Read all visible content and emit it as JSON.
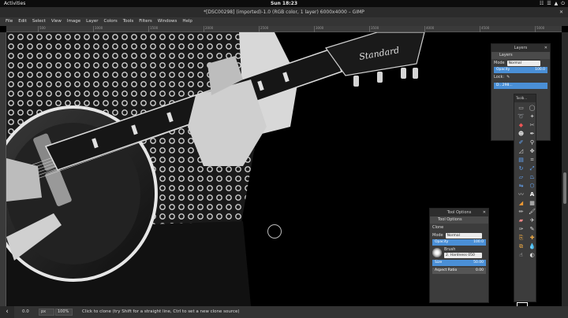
{
  "topbar": {
    "activities": "Activities",
    "clock": "Sun 18:23",
    "system_icons": [
      "☷",
      "☰",
      "▲",
      "⏻"
    ]
  },
  "window": {
    "title": "*[DSC00298] (imported)-1.0 (RGB color, 1 layer) 6000x4000 – GIMP",
    "close": "✕"
  },
  "menu": [
    "File",
    "Edit",
    "Select",
    "View",
    "Image",
    "Layer",
    "Colors",
    "Tools",
    "Filters",
    "Windows",
    "Help"
  ],
  "ruler_ticks": [
    "500",
    "1000",
    "1500",
    "2000",
    "2500",
    "3000",
    "3500",
    "4000",
    "4500",
    "5000"
  ],
  "layers": {
    "title": "Layers",
    "tab": "Layers",
    "mode_label": "Mode",
    "mode_value": "Normal",
    "opacity_label": "Opacity",
    "opacity_value": "100.0",
    "lock_label": "Lock:",
    "layer_name": "D...298..."
  },
  "toolbox": {
    "title": "Toolb..."
  },
  "tool_options": {
    "title": "Tool Options",
    "tab": "Tool Options",
    "heading": "Clone",
    "mode_label": "Mode",
    "mode_value": "Normal",
    "opacity_label": "Opacity",
    "opacity_value": "100.0",
    "brush_label": "Brush",
    "brush_value": "2. Hardness 050",
    "size_label": "Size",
    "size_value": "50.00",
    "aspect_label": "Aspect Ratio",
    "aspect_value": "0.00"
  },
  "status": {
    "coord": "0.0",
    "unit": "px",
    "zoom": "100%",
    "message": "Click to clone (try Shift for a straight line, Ctrl to set a new clone source)",
    "back": "‹"
  },
  "photo": {
    "guitar_brand": "Standard"
  }
}
